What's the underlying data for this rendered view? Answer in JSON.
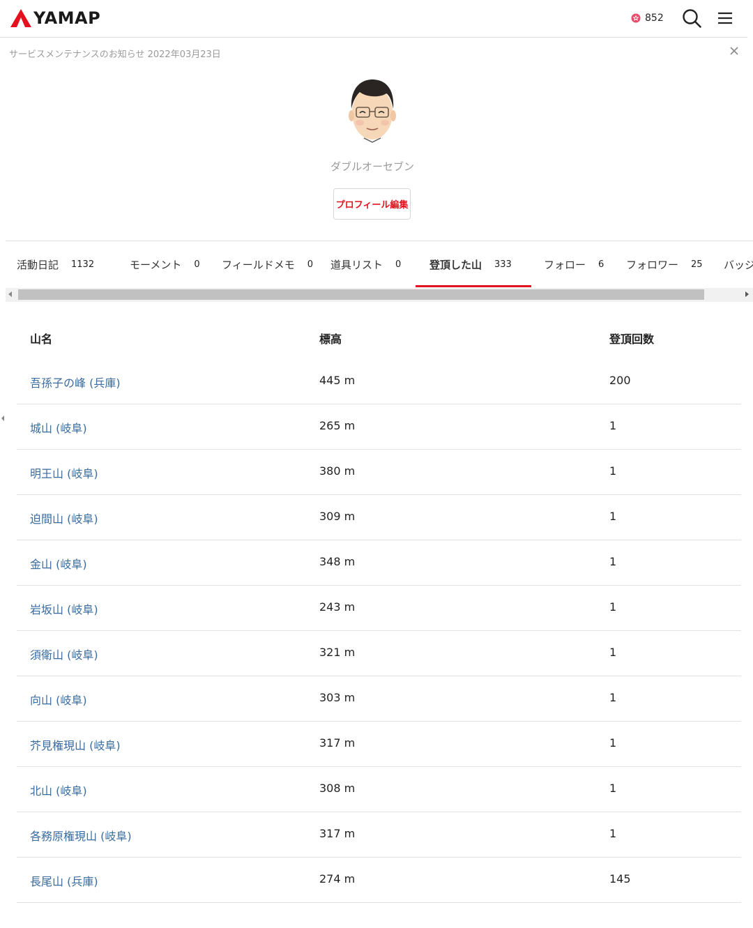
{
  "header": {
    "logo_text": "YAMAP",
    "points": "852"
  },
  "notice": {
    "text": "サービスメンテナンスのお知らせ 2022年03月23日"
  },
  "profile": {
    "username": "ダブルオーセブン",
    "edit_label": "プロフィール編集"
  },
  "tabs": [
    {
      "label": "活動日記",
      "count": "1132"
    },
    {
      "label": "モーメント",
      "count": "0"
    },
    {
      "label": "フィールドメモ",
      "count": "0"
    },
    {
      "label": "道具リスト",
      "count": "0"
    },
    {
      "label": "登頂した山",
      "count": "333"
    },
    {
      "label": "フォロー",
      "count": "6"
    },
    {
      "label": "フォロワー",
      "count": "25"
    },
    {
      "label": "バッジ",
      "count": ""
    }
  ],
  "table": {
    "headers": [
      "山名",
      "標高",
      "登頂回数"
    ],
    "rows": [
      {
        "name": "吾孫子の峰 (兵庫)",
        "elevation": "445 m",
        "count": "200"
      },
      {
        "name": "城山 (岐阜)",
        "elevation": "265 m",
        "count": "1"
      },
      {
        "name": "明王山 (岐阜)",
        "elevation": "380 m",
        "count": "1"
      },
      {
        "name": "迫間山 (岐阜)",
        "elevation": "309 m",
        "count": "1"
      },
      {
        "name": "金山 (岐阜)",
        "elevation": "348 m",
        "count": "1"
      },
      {
        "name": "岩坂山 (岐阜)",
        "elevation": "243 m",
        "count": "1"
      },
      {
        "name": "須衛山 (岐阜)",
        "elevation": "321 m",
        "count": "1"
      },
      {
        "name": "向山 (岐阜)",
        "elevation": "303 m",
        "count": "1"
      },
      {
        "name": "芥見権現山 (岐阜)",
        "elevation": "317 m",
        "count": "1"
      },
      {
        "name": "北山 (岐阜)",
        "elevation": "308 m",
        "count": "1"
      },
      {
        "name": "各務原権現山 (岐阜)",
        "elevation": "317 m",
        "count": "1"
      },
      {
        "name": "長尾山 (兵庫)",
        "elevation": "274 m",
        "count": "145"
      }
    ]
  },
  "colors": {
    "brand_red": "#e5101d",
    "link_blue": "#3a6b9e"
  }
}
